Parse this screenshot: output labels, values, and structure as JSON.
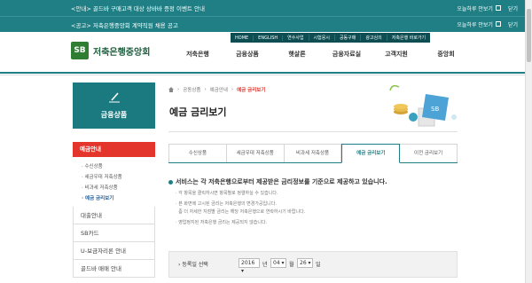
{
  "notice_bar_1": {
    "text": "<안내> 골드바 구매고객 대상 상바바 증정 이벤트 안내",
    "dont_show_today": "오늘하루 안보기",
    "close": "닫기"
  },
  "notice_bar_2": {
    "text": "<공고> 저축은행중앙회 계약직원 채용 공고",
    "dont_show_today": "오늘하루 안보기",
    "close": "닫기"
  },
  "utility_links": [
    "HOME",
    "ENGLISH",
    "연수사업",
    "시험응시",
    "공동구매",
    "광고심의",
    "저축은행 바로가기"
  ],
  "logo": {
    "mark": "SB",
    "name": "저축은행중앙회"
  },
  "gnb": [
    "저축은행",
    "금융상품",
    "햇살론",
    "금융자료실",
    "고객지원",
    "중앙회"
  ],
  "side_banner": {
    "title": "금융상품"
  },
  "side_menu": {
    "active_head": "예금안내",
    "sub_items": [
      "수신상품",
      "세금우대 저축상품",
      "비과세 저축상품",
      "예금 금리보기"
    ],
    "items": [
      "대출안내",
      "SB카드",
      "U-보금자리론 안내",
      "골드바 매매 안내"
    ]
  },
  "breadcrumb": [
    "공동상품",
    "예금안내",
    "예금 금리보기"
  ],
  "page_title": "예금 금리보기",
  "tabs": [
    "수신상품",
    "세금우대 저축상품",
    "비과세 저축상품",
    "예금 금리보기",
    "이전 금리보기"
  ],
  "intro": "서비스는 각 저축은행으로부터 제공받은 금리정보를 기준으로 제공하고 있습니다.",
  "notes": [
    "각 항목을 클릭하시면 항목별로 정렬하실 수 있습니다.",
    "본 화면에 고시된 금리는 저축은행의 변경가공입니다.",
    "좀 더 자세한 지점별 금리는 해당 저축은행으로 연락하시기 바랍니다.",
    "영업정지된 저축은행 금리는 제공되지 않습니다."
  ],
  "date_select": {
    "label": "등록일 선택",
    "year": "2016",
    "year_unit": "년",
    "month": "04",
    "month_unit": "월",
    "day": "26",
    "day_unit": "일"
  },
  "colors": {
    "teal": "#1f7f84",
    "red": "#e4352c",
    "dark_teal": "#0e4d52"
  }
}
